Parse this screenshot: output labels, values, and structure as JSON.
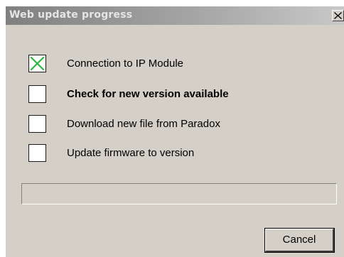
{
  "window": {
    "title": "Web update progress",
    "close_icon": "close-icon"
  },
  "steps": [
    {
      "label": "Connection to IP Module",
      "checked": true,
      "active": false
    },
    {
      "label": "Check for new version available",
      "checked": false,
      "active": true
    },
    {
      "label": "Download new file from Paradox",
      "checked": false,
      "active": false
    },
    {
      "label": "Update firmware to version",
      "checked": false,
      "active": false
    }
  ],
  "progress": {
    "value_percent": 0
  },
  "buttons": {
    "cancel_label": "Cancel"
  },
  "colors": {
    "dialog_background": "#d4d0c8",
    "checkmark": "#2db83d",
    "title_text": "#e6e6e6"
  }
}
